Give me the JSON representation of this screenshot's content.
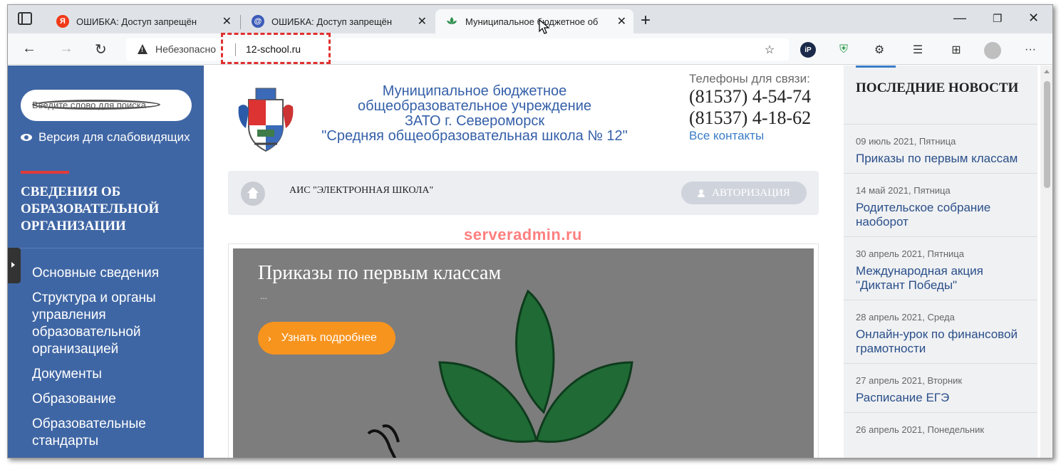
{
  "browser": {
    "tabs": [
      {
        "label": "ОШИБКА: Доступ запрещён",
        "icon": "yandex-icon",
        "color": "#f03a17",
        "active": false
      },
      {
        "label": "ОШИБКА: Доступ запрещён",
        "icon": "mail-at-icon",
        "color": "#3d5bb8",
        "active": false
      },
      {
        "label": "Муниципальное бюджетное об",
        "icon": "school-favicon-icon",
        "color": "#2f8f4e",
        "active": true
      }
    ],
    "tab_close": "✕",
    "new_tab": "+",
    "security_label": "Небезопасно",
    "url": "12-school.ru"
  },
  "sidebar": {
    "search_placeholder": "Введите слово для поиска",
    "low_vision_label": "Версия для слабовидящих",
    "heading": "СВЕДЕНИЯ ОБ ОБРАЗОВАТЕЛЬНОЙ ОРГАНИЗАЦИИ",
    "menu": [
      "Основные сведения",
      "Структура и органы управления образовательной организацией",
      "Документы",
      "Образование",
      "Образовательные стандарты"
    ]
  },
  "header": {
    "name_lines": [
      "Муниципальное бюджетное",
      "общеобразовательное учреждение",
      "ЗАТО г. Североморск",
      "\"Средняя общеобразовательная школа № 12\""
    ],
    "phones_label": "Телефоны для связи:",
    "phones": [
      "(81537) 4-54-74",
      "(81537) 4-18-62"
    ],
    "contacts_link": "Все контакты"
  },
  "ais_bar": {
    "label": "АИС \"ЭЛЕКТРОННАЯ ШКОЛА\"",
    "auth_button": "АВТОРИЗАЦИЯ"
  },
  "watermark": "serveradmin.ru",
  "slider": {
    "title": "Приказы по первым классам",
    "dots": "...",
    "more_button": "Узнать подробнее"
  },
  "news": {
    "title": "ПОСЛЕДНИЕ НОВОСТИ",
    "items": [
      {
        "date": "09 июль 2021, Пятница",
        "text": "Приказы по первым классам"
      },
      {
        "date": "14 май 2021, Пятница",
        "text": "Родительское собрание наоборот"
      },
      {
        "date": "30 апрель 2021, Пятница",
        "text": "Международная акция \"Диктант Победы\""
      },
      {
        "date": "28 апрель 2021, Среда",
        "text": "Онлайн-урок по финансовой грамотности"
      },
      {
        "date": "27 апрель 2021, Вторник",
        "text": "Расписание ЕГЭ"
      },
      {
        "date": "26 апрель 2021, Понедельник",
        "text": ""
      }
    ]
  },
  "colors": {
    "sidebar": "#3f66a4",
    "accent_red": "#e23b3b",
    "button_orange": "#f7941e",
    "link_blue": "#3a7cc7",
    "url_highlight": "#e03030"
  }
}
